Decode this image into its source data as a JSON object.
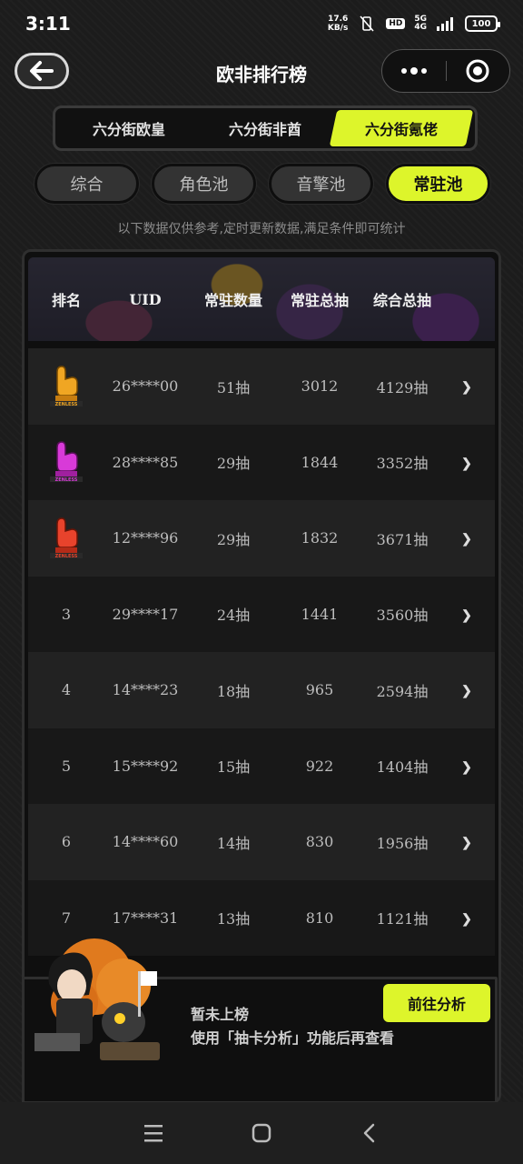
{
  "status_bar": {
    "time": "3:11",
    "net_speed_value": "17.6",
    "net_speed_unit": "KB/s",
    "hd": "HD",
    "network": "5G",
    "network_sub": "4G",
    "battery": "100"
  },
  "header": {
    "title": "欧非排行榜"
  },
  "main_tabs": [
    "六分街欧皇",
    "六分街非酋",
    "六分街氪佬"
  ],
  "main_tabs_active": "六分街氪佬",
  "sub_tabs": [
    "综合",
    "角色池",
    "音擎池",
    "常驻池"
  ],
  "sub_tabs_active": "常驻池",
  "notice": "以下数据仅供参考,定时更新数据,满足条件即可统计",
  "table": {
    "headers": [
      "排名",
      "UID",
      "常驻数量",
      "常驻总抽",
      "综合总抽"
    ],
    "rows": [
      {
        "rank": "",
        "uid": "26****00",
        "count": "51抽",
        "total": "3012",
        "all": "4129抽"
      },
      {
        "rank": "",
        "uid": "28****85",
        "count": "29抽",
        "total": "1844",
        "all": "3352抽"
      },
      {
        "rank": "",
        "uid": "12****96",
        "count": "29抽",
        "total": "1832",
        "all": "3671抽"
      },
      {
        "rank": "3",
        "uid": "29****17",
        "count": "24抽",
        "total": "1441",
        "all": "3560抽"
      },
      {
        "rank": "4",
        "uid": "14****23",
        "count": "18抽",
        "total": "965",
        "all": "2594抽"
      },
      {
        "rank": "5",
        "uid": "15****92",
        "count": "15抽",
        "total": "922",
        "all": "1404抽"
      },
      {
        "rank": "6",
        "uid": "14****60",
        "count": "14抽",
        "total": "830",
        "all": "1956抽"
      },
      {
        "rank": "7",
        "uid": "17****31",
        "count": "13抽",
        "total": "810",
        "all": "1121抽"
      }
    ]
  },
  "trophies": [
    {
      "color": "#f0a623",
      "label": "ZENLESS"
    },
    {
      "color": "#d83ad8",
      "label": "ZENLESS"
    },
    {
      "color": "#e8432c",
      "label": "ZENLESS"
    }
  ],
  "promo": {
    "title": "暂未上榜",
    "subtitle": "使用「抽卡分析」功能后再查看",
    "button": "前往分析"
  },
  "colors": {
    "accent": "#ddf52b",
    "background": "#1c1c1c"
  }
}
